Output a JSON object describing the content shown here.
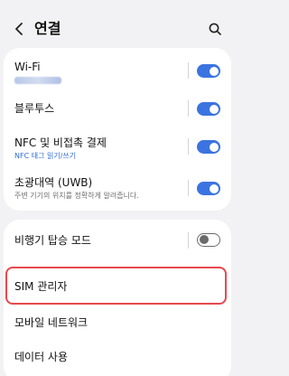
{
  "header": {
    "title": "연결"
  },
  "connectivity": {
    "wifi": {
      "title": "Wi-Fi",
      "enabled": true
    },
    "bluetooth": {
      "title": "블루투스",
      "enabled": true
    },
    "nfc": {
      "title": "NFC 및 비접촉 결제",
      "subtitle": "NFC 태그 읽기/쓰기",
      "enabled": true
    },
    "uwb": {
      "title": "초광대역 (UWB)",
      "subtitle": "주변 기기의 위치를 정확하게 알려줍니다.",
      "enabled": true
    }
  },
  "more": {
    "airplane": {
      "title": "비행기 탑승 모드",
      "enabled": false
    },
    "sim_manager": {
      "title": "SIM 관리자"
    },
    "mobile_network": {
      "title": "모바일 네트워크"
    },
    "data_usage": {
      "title": "데이터 사용"
    }
  },
  "colors": {
    "accent": "#3b73e0",
    "highlight": "#e8484e",
    "background": "#f2f2f4"
  }
}
